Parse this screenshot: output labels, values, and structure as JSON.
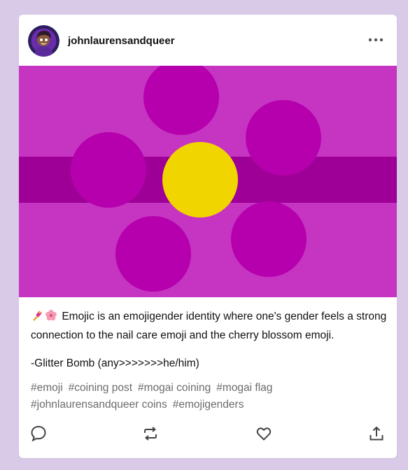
{
  "post": {
    "username": "johnlaurensandqueer",
    "flag": {
      "background_color": "#c535c2",
      "stripe_color": "#9e0097",
      "petal_color": "#b600ae",
      "center_color": "#f0d500"
    },
    "body": {
      "line1": "Emojic is an emojigender identity where one's gender feels a strong connection to the nail care emoji and the cherry blossom emoji.",
      "emoji1": "nail-care-emoji",
      "emoji2": "cherry-blossom-emoji",
      "line2": "-Glitter Bomb (any>>>>>>>he/him)"
    },
    "tags": [
      "#emoji",
      "#coining post",
      "#mogai coining",
      "#mogai flag",
      "#johnlaurensandqueer coins",
      "#emojigenders"
    ],
    "actions": {
      "reply_icon": "speech-bubble-icon",
      "reblog_icon": "reblog-icon",
      "like_icon": "heart-icon",
      "share_icon": "share-icon"
    }
  }
}
